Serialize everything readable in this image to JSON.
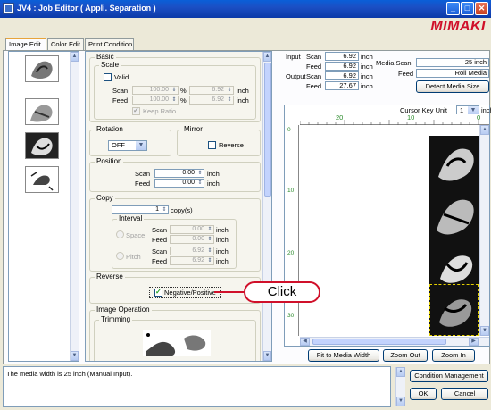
{
  "window": {
    "title": "JV4 : Job Editor ( Appli. Separation )",
    "brand": "MIMAKI"
  },
  "tabs": [
    {
      "label": "Image Edit"
    },
    {
      "label": "Color Edit"
    },
    {
      "label": "Print Condition"
    }
  ],
  "basic": {
    "label": "Basic",
    "scale": {
      "label": "Scale",
      "valid_label": "Valid",
      "valid": false,
      "scan_label": "Scan",
      "feed_label": "Feed",
      "scan_pct": "100.00",
      "feed_pct": "100.00",
      "pct_unit": "%",
      "scan_inch": "6.92",
      "feed_inch": "6.92",
      "inch_unit": "inch",
      "keep_ratio_label": "Keep Ratio",
      "keep_ratio": true
    }
  },
  "rotation": {
    "label": "Rotation",
    "value": "OFF"
  },
  "mirror": {
    "label": "Mirror",
    "reverse_label": "Reverse",
    "reverse": false
  },
  "position": {
    "label": "Position",
    "scan_label": "Scan",
    "feed_label": "Feed",
    "scan": "0.00",
    "feed": "0.00",
    "unit": "inch"
  },
  "copy": {
    "label": "Copy",
    "count": "1",
    "count_unit": "copy(s)",
    "interval_label": "Interval",
    "space_label": "Space",
    "pitch_label": "Pitch",
    "scan_label": "Scan",
    "feed_label": "Feed",
    "space_scan": "0.00",
    "space_feed": "0.00",
    "pitch_scan": "6.92",
    "pitch_feed": "6.92",
    "unit": "inch"
  },
  "reverse": {
    "label": "Reverse",
    "negpos_label": "Negative/Positive",
    "negpos": true
  },
  "image_operation": {
    "label": "Image Operation",
    "trimming_label": "Trimming"
  },
  "info": {
    "input_label": "Input",
    "output_label": "Output",
    "scan_label": "Scan",
    "feed_label": "Feed",
    "input_scan": "6.92",
    "input_feed": "6.92",
    "output_scan": "6.92",
    "output_feed": "27.67",
    "unit": "inch",
    "media_scan_label": "Media Scan",
    "media_scan": "25 inch",
    "feed_label2": "Feed",
    "media_feed": "Roll Media",
    "detect_btn": "Detect Media Size",
    "cursor_key_label": "Cursor Key Unit",
    "cursor_key_value": "1",
    "cursor_key_unit": "inch"
  },
  "ruler": {
    "top_ticks": [
      "20",
      "10",
      "0"
    ],
    "left_ticks": [
      "0",
      "10",
      "20",
      "30"
    ]
  },
  "preview_buttons": {
    "fit": "Fit to Media Width",
    "zoom_out": "Zoom Out",
    "zoom_in": "Zoom In"
  },
  "callout": {
    "text": "Click"
  },
  "status": {
    "message": "The media width is 25 inch (Manual Input).",
    "condition_btn": "Condition Management",
    "ok_btn": "OK",
    "cancel_btn": "Cancel"
  },
  "colors": {
    "accent": "#d0102a",
    "titlebar": "#0b3aa8",
    "panel": "#f6f5ee"
  }
}
